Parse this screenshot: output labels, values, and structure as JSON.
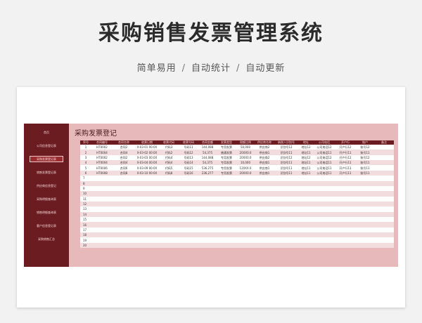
{
  "hero": {
    "title": "采购销售发票管理系统",
    "features": [
      "简单易用",
      "自动统计",
      "自动更新"
    ],
    "separator": "/"
  },
  "colors": {
    "sidebar": "#6b1c20",
    "panel": "#e7b9bb",
    "row_alt": "#f2dcdd"
  },
  "sidebar": {
    "home": "首页",
    "items": [
      {
        "label": "公司信息登记表",
        "active": false
      },
      {
        "label": "采购发票登记表",
        "active": true
      },
      {
        "label": "销售发票登记表",
        "active": false
      },
      {
        "label": "供应商信息登记",
        "active": false
      },
      {
        "label": "采购明细查询表",
        "active": false
      },
      {
        "label": "销售明细查询表",
        "active": false
      },
      {
        "label": "客户信息登记表",
        "active": false
      },
      {
        "label": "采购销售汇总",
        "active": false
      }
    ]
  },
  "main": {
    "title": "采购发票登记",
    "columns": [
      "序号",
      "合同编号",
      "合同名称",
      "收票日期",
      "收票代码",
      "收票号码",
      "合同金额",
      "发票类型",
      "税额比例",
      "供应商名称",
      "纳税人识别号",
      "地址",
      "公司电话",
      "开户行",
      "账户",
      "备注"
    ],
    "rows": [
      [
        "1",
        "HT0002",
        "合同2",
        "X-03-01 00:0X",
        "代码3",
        "号码11",
        "144,088",
        "专用发票",
        "50,000",
        "供应商2",
        "识别号12",
        "地址12",
        "公司电话12",
        "开户行12",
        "账号12",
        ""
      ],
      [
        "2",
        "HT0004",
        "合同4",
        "X-03-02 00:0X",
        "代码2",
        "号码12",
        "54,375",
        "普通发票",
        "20XX0.0",
        "供应商1",
        "识别号11",
        "地址11",
        "公司电话11",
        "开户行11",
        "账号11",
        ""
      ],
      [
        "3",
        "HT0002",
        "合同2",
        "X-03-03 00:0X",
        "代码4",
        "号码13",
        "144,088",
        "专用发票",
        "20XX0.0",
        "供应商2",
        "识别号12",
        "地址12",
        "公司电话12",
        "开户行12",
        "账号12",
        ""
      ],
      [
        "4",
        "HT0004",
        "合同4",
        "X-03-04 00:0X",
        "代码4",
        "号码14",
        "54,375",
        "专用发票",
        "10,000",
        "供应商1",
        "识别号11",
        "地址11",
        "公司电话11",
        "开户行11",
        "账号11",
        ""
      ],
      [
        "5",
        "HT0006",
        "合同6",
        "X-03-09 00:0X",
        "代码5",
        "号码15",
        "536,275",
        "专用发票",
        "120XX.0",
        "供应商1",
        "识别号11",
        "地址11",
        "公司电话11",
        "开户行11",
        "账号11",
        ""
      ],
      [
        "6",
        "HT0008",
        "合同8",
        "X-03-10 00:0X",
        "代码8",
        "号码16",
        "236,277",
        "专用发票",
        "20XX0.0",
        "供应商1",
        "识别号11",
        "地址11",
        "公司电话11",
        "开户行11",
        "账号11",
        ""
      ],
      [
        "7"
      ],
      [
        "8"
      ],
      [
        "9"
      ],
      [
        "10"
      ],
      [
        "11"
      ],
      [
        "12"
      ],
      [
        "13"
      ],
      [
        "14"
      ],
      [
        "15"
      ],
      [
        "16"
      ],
      [
        "17"
      ],
      [
        "18"
      ],
      [
        "19"
      ],
      [
        "20"
      ]
    ]
  }
}
